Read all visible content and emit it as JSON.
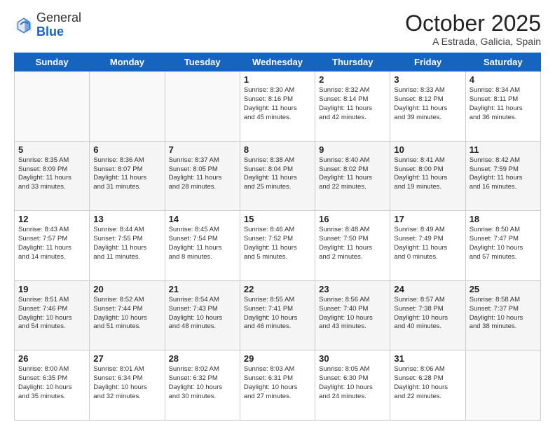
{
  "header": {
    "logo_general": "General",
    "logo_blue": "Blue",
    "month": "October 2025",
    "location": "A Estrada, Galicia, Spain"
  },
  "weekdays": [
    "Sunday",
    "Monday",
    "Tuesday",
    "Wednesday",
    "Thursday",
    "Friday",
    "Saturday"
  ],
  "weeks": [
    [
      {
        "day": "",
        "info": ""
      },
      {
        "day": "",
        "info": ""
      },
      {
        "day": "",
        "info": ""
      },
      {
        "day": "1",
        "info": "Sunrise: 8:30 AM\nSunset: 8:16 PM\nDaylight: 11 hours\nand 45 minutes."
      },
      {
        "day": "2",
        "info": "Sunrise: 8:32 AM\nSunset: 8:14 PM\nDaylight: 11 hours\nand 42 minutes."
      },
      {
        "day": "3",
        "info": "Sunrise: 8:33 AM\nSunset: 8:12 PM\nDaylight: 11 hours\nand 39 minutes."
      },
      {
        "day": "4",
        "info": "Sunrise: 8:34 AM\nSunset: 8:11 PM\nDaylight: 11 hours\nand 36 minutes."
      }
    ],
    [
      {
        "day": "5",
        "info": "Sunrise: 8:35 AM\nSunset: 8:09 PM\nDaylight: 11 hours\nand 33 minutes."
      },
      {
        "day": "6",
        "info": "Sunrise: 8:36 AM\nSunset: 8:07 PM\nDaylight: 11 hours\nand 31 minutes."
      },
      {
        "day": "7",
        "info": "Sunrise: 8:37 AM\nSunset: 8:05 PM\nDaylight: 11 hours\nand 28 minutes."
      },
      {
        "day": "8",
        "info": "Sunrise: 8:38 AM\nSunset: 8:04 PM\nDaylight: 11 hours\nand 25 minutes."
      },
      {
        "day": "9",
        "info": "Sunrise: 8:40 AM\nSunset: 8:02 PM\nDaylight: 11 hours\nand 22 minutes."
      },
      {
        "day": "10",
        "info": "Sunrise: 8:41 AM\nSunset: 8:00 PM\nDaylight: 11 hours\nand 19 minutes."
      },
      {
        "day": "11",
        "info": "Sunrise: 8:42 AM\nSunset: 7:59 PM\nDaylight: 11 hours\nand 16 minutes."
      }
    ],
    [
      {
        "day": "12",
        "info": "Sunrise: 8:43 AM\nSunset: 7:57 PM\nDaylight: 11 hours\nand 14 minutes."
      },
      {
        "day": "13",
        "info": "Sunrise: 8:44 AM\nSunset: 7:55 PM\nDaylight: 11 hours\nand 11 minutes."
      },
      {
        "day": "14",
        "info": "Sunrise: 8:45 AM\nSunset: 7:54 PM\nDaylight: 11 hours\nand 8 minutes."
      },
      {
        "day": "15",
        "info": "Sunrise: 8:46 AM\nSunset: 7:52 PM\nDaylight: 11 hours\nand 5 minutes."
      },
      {
        "day": "16",
        "info": "Sunrise: 8:48 AM\nSunset: 7:50 PM\nDaylight: 11 hours\nand 2 minutes."
      },
      {
        "day": "17",
        "info": "Sunrise: 8:49 AM\nSunset: 7:49 PM\nDaylight: 11 hours\nand 0 minutes."
      },
      {
        "day": "18",
        "info": "Sunrise: 8:50 AM\nSunset: 7:47 PM\nDaylight: 10 hours\nand 57 minutes."
      }
    ],
    [
      {
        "day": "19",
        "info": "Sunrise: 8:51 AM\nSunset: 7:46 PM\nDaylight: 10 hours\nand 54 minutes."
      },
      {
        "day": "20",
        "info": "Sunrise: 8:52 AM\nSunset: 7:44 PM\nDaylight: 10 hours\nand 51 minutes."
      },
      {
        "day": "21",
        "info": "Sunrise: 8:54 AM\nSunset: 7:43 PM\nDaylight: 10 hours\nand 48 minutes."
      },
      {
        "day": "22",
        "info": "Sunrise: 8:55 AM\nSunset: 7:41 PM\nDaylight: 10 hours\nand 46 minutes."
      },
      {
        "day": "23",
        "info": "Sunrise: 8:56 AM\nSunset: 7:40 PM\nDaylight: 10 hours\nand 43 minutes."
      },
      {
        "day": "24",
        "info": "Sunrise: 8:57 AM\nSunset: 7:38 PM\nDaylight: 10 hours\nand 40 minutes."
      },
      {
        "day": "25",
        "info": "Sunrise: 8:58 AM\nSunset: 7:37 PM\nDaylight: 10 hours\nand 38 minutes."
      }
    ],
    [
      {
        "day": "26",
        "info": "Sunrise: 8:00 AM\nSunset: 6:35 PM\nDaylight: 10 hours\nand 35 minutes."
      },
      {
        "day": "27",
        "info": "Sunrise: 8:01 AM\nSunset: 6:34 PM\nDaylight: 10 hours\nand 32 minutes."
      },
      {
        "day": "28",
        "info": "Sunrise: 8:02 AM\nSunset: 6:32 PM\nDaylight: 10 hours\nand 30 minutes."
      },
      {
        "day": "29",
        "info": "Sunrise: 8:03 AM\nSunset: 6:31 PM\nDaylight: 10 hours\nand 27 minutes."
      },
      {
        "day": "30",
        "info": "Sunrise: 8:05 AM\nSunset: 6:30 PM\nDaylight: 10 hours\nand 24 minutes."
      },
      {
        "day": "31",
        "info": "Sunrise: 8:06 AM\nSunset: 6:28 PM\nDaylight: 10 hours\nand 22 minutes."
      },
      {
        "day": "",
        "info": ""
      }
    ]
  ]
}
